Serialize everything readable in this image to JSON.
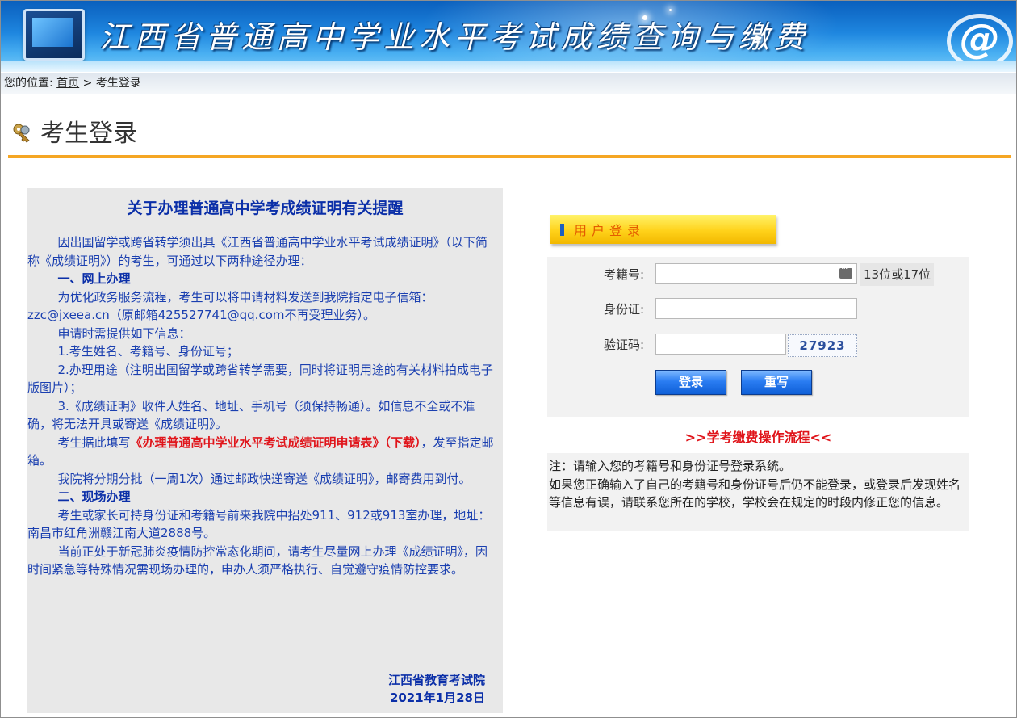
{
  "banner": {
    "title": "江西省普通高中学业水平考试成绩查询与缴费"
  },
  "breadcrumb": {
    "prefix": "您的位置: ",
    "home": "首页",
    "sep": " > ",
    "current": "考生登录"
  },
  "page_title": "考生登录",
  "notice": {
    "title": "关于办理普通高中学考成绩证明有关提醒",
    "p1": "因出国留学或跨省转学须出具《江西省普通高中学业水平考试成绩证明》（以下简称《成绩证明》）的考生，可通过以下两种途径办理：",
    "s1": "一、网上办理",
    "p2": "为优化政务服务流程，考生可以将申请材料发送到我院指定电子信箱：zzc@jxeea.cn（原邮箱425527741@qq.com不再受理业务）。",
    "p3": "申请时需提供如下信息：",
    "p4": "1.考生姓名、考籍号、身份证号；",
    "p5": "2.办理用途（注明出国留学或跨省转学需要，同时将证明用途的有关材料拍成电子版图片）；",
    "p6": "3.《成绩证明》收件人姓名、地址、手机号（须保持畅通）。如信息不全或不准确，将无法开具或寄送《成绩证明》。",
    "p7a": "考生据此填写",
    "p7b": "《办理普通高中学业水平考试成绩证明申请表》",
    "p7c": "（下载）",
    "p7d": "，发至指定邮箱。",
    "p8": "我院将分期分批（一周1次）通过邮政快递寄送《成绩证明》，邮寄费用到付。",
    "s2": "二、现场办理",
    "p9": "考生或家长可持身份证和考籍号前来我院中招处911、912或913室办理，地址：南昌市红角洲赣江南大道2888号。",
    "p10": "当前正处于新冠肺炎疫情防控常态化期间，请考生尽量网上办理《成绩证明》，因时间紧急等特殊情况需现场办理的，申办人须严格执行、自觉遵守疫情防控要求。",
    "org": "江西省教育考试院",
    "date": "2021年1月28日"
  },
  "login": {
    "tab_title": "用户登录",
    "exam_no_label": "考籍号:",
    "exam_no_value": "",
    "exam_no_hint": "13位或17位",
    "id_label": "身份证:",
    "id_value": "",
    "captcha_label": "验证码:",
    "captcha_value": "",
    "captcha_code": "27923",
    "login_button": "登录",
    "reset_button": "重写"
  },
  "flow_link": ">>学考缴费操作流程<<",
  "tips": {
    "line1": "注：请输入您的考籍号和身份证号登录系统。",
    "line2": "如果您正确输入了自己的考籍号和身份证号后仍不能登录，或登录后发现姓名等信息有误，请联系您所在的学校，学校会在规定的时段内修正您的信息。"
  },
  "colors": {
    "accent_orange": "#f5a623",
    "notice_blue": "#1a3fb0",
    "alert_red": "#e0141a",
    "button_blue": "#0f5fd7"
  }
}
